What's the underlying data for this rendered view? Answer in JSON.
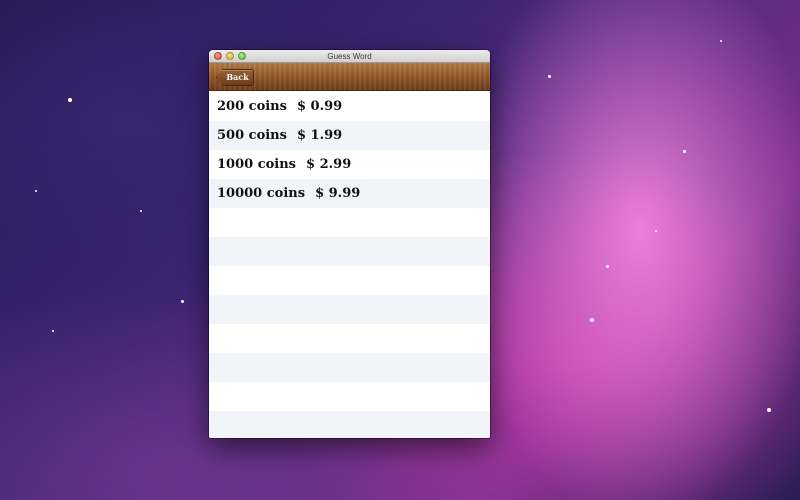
{
  "window": {
    "title": "Guess Word"
  },
  "toolbar": {
    "back_label": "Back"
  },
  "products": [
    {
      "coins": "200 coins",
      "price": "$ 0.99"
    },
    {
      "coins": "500 coins",
      "price": "$ 1.99"
    },
    {
      "coins": "1000 coins",
      "price": "$ 2.99"
    },
    {
      "coins": "10000 coins",
      "price": "$ 9.99"
    }
  ],
  "colors": {
    "toolbar_wood": "#8c5426",
    "row_alt": "#f1f4f8"
  }
}
